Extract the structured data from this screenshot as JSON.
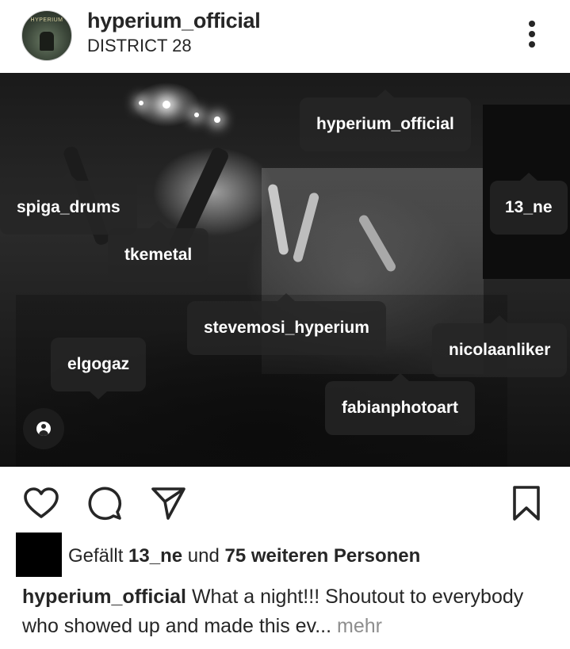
{
  "post": {
    "username": "hyperium_official",
    "location": "DISTRICT 28",
    "avatar_text": "HYPERIUM"
  },
  "tags": {
    "t1": "hyperium_official",
    "t2": "spiga_drums",
    "t3": "13_ne",
    "t4": "tkemetal",
    "t5": "stevemosi_hyperium",
    "t6": "nicolaanliker",
    "t7": "elgogaz",
    "t8": "fabianphotoart"
  },
  "likes": {
    "prefix": "Gefällt",
    "user": "13_ne",
    "middle": "und",
    "count_text": "75 weiteren Personen"
  },
  "caption": {
    "username": "hyperium_official",
    "text": "What a night!!! Shoutout to everybody who showed up and made this ev...",
    "more_label": "mehr"
  },
  "icons": {
    "more": "more-vertical-icon",
    "like": "heart-icon",
    "comment": "comment-icon",
    "share": "send-icon",
    "save": "bookmark-icon",
    "tagged": "user-tag-icon"
  }
}
